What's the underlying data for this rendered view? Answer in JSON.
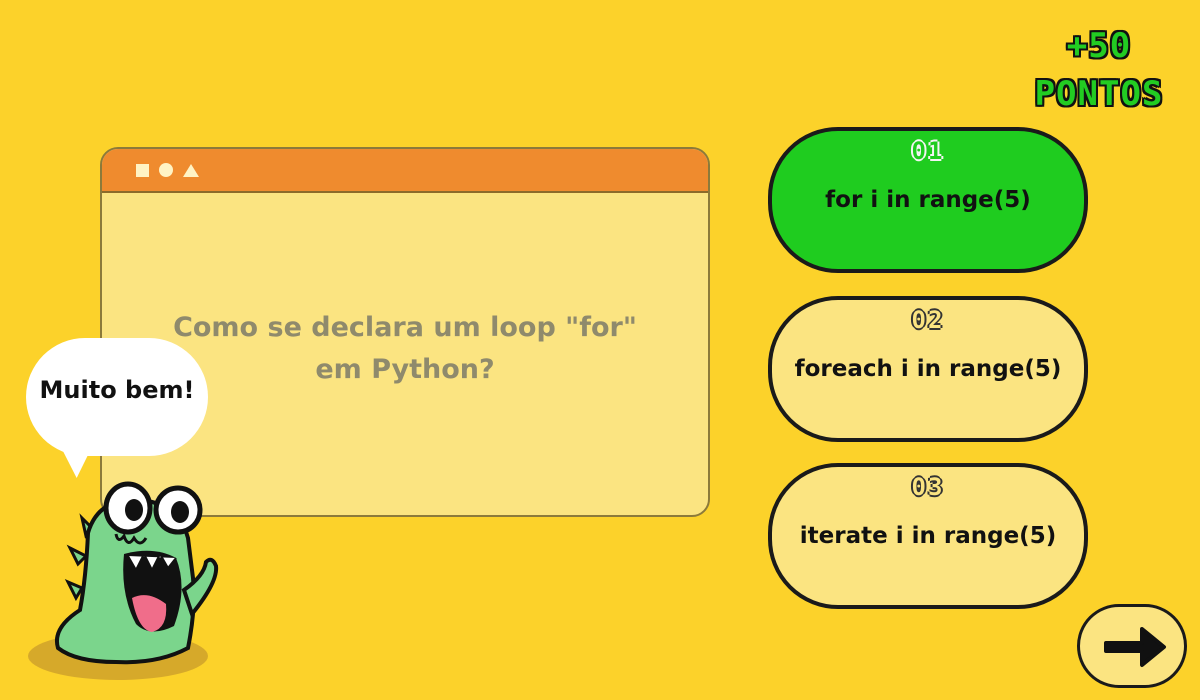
{
  "score": {
    "line1": "+50",
    "line2": "PONTOS",
    "color": "#22cc22"
  },
  "question": {
    "line1": "Como se declara um loop \"for\"",
    "line2": "em Python?"
  },
  "window_controls": [
    "square",
    "circle",
    "triangle"
  ],
  "options": [
    {
      "number": "01",
      "label": "for i in range(5)",
      "state": "correct",
      "color": "#1fcc1f"
    },
    {
      "number": "02",
      "label": "foreach i in range(5)",
      "state": "neutral",
      "color": "#fbe481"
    },
    {
      "number": "03",
      "label": "iterate i in range(5)",
      "state": "neutral",
      "color": "#fbe481"
    }
  ],
  "speech": {
    "text": "Muito bem!"
  },
  "icons": {
    "next": "arrow-right-icon",
    "mascot": "green-dinosaur-mascot"
  },
  "colors": {
    "background": "#fcd22a",
    "window_bar": "#ef8b2e",
    "window_body": "#fbe481"
  }
}
